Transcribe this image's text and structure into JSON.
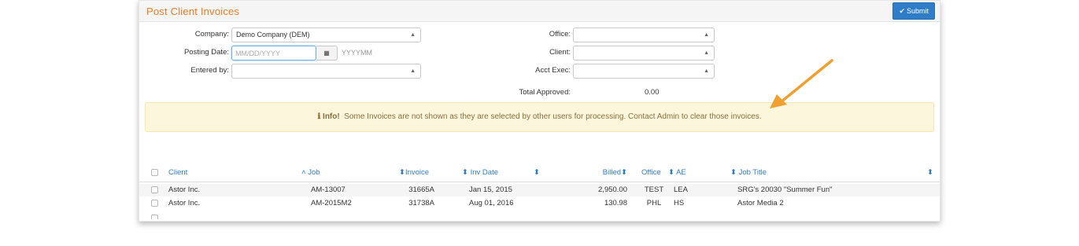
{
  "page": {
    "title": "Post Client Invoices",
    "submit_label": "Submit"
  },
  "form": {
    "company_label": "Company:",
    "company_value": "Demo Company (DEM)",
    "posting_date_label": "Posting Date:",
    "posting_date_placeholder": "MM/DD/YYYY",
    "period_placeholder": "YYYYMM",
    "entered_by_label": "Entered by:",
    "entered_by_value": "",
    "office_label": "Office:",
    "office_value": "",
    "client_label": "Client:",
    "client_value": "",
    "acct_exec_label": "Acct Exec:",
    "acct_exec_value": "",
    "total_approved_label": "Total Approved:",
    "total_approved_value": "0.00"
  },
  "info": {
    "prefix": "Info!",
    "message": "Some Invoices are not shown as they are selected by other users for processing. Contact Admin to clear those invoices."
  },
  "table": {
    "columns": {
      "client": "Client",
      "job": "Job",
      "invoice": "Invoice",
      "inv_date": "Inv Date",
      "billed": "Billed",
      "office": "Office",
      "ae": "AE",
      "job_title": "Job Title"
    },
    "rows": [
      {
        "client": "Astor Inc.",
        "job": "AM-13007",
        "invoice": "31665A",
        "inv_date": "Jan 15, 2015",
        "billed": "2,950.00",
        "office": "TEST",
        "ae": "LEA",
        "job_title": "SRG's 20030 \"Summer Fun\""
      },
      {
        "client": "Astor Inc.",
        "job": "AM-2015M2",
        "invoice": "31738A",
        "inv_date": "Aug 01, 2016",
        "billed": "130.98",
        "office": "PHL",
        "ae": "HS",
        "job_title": "Astor Media 2"
      }
    ]
  },
  "colors": {
    "accent": "#ee7b23",
    "link": "#2f7dc8",
    "info_bg": "#fcf7dc",
    "arrow": "#f0a030"
  },
  "icons": {
    "submit": "check-icon",
    "calendar": "calendar-icon",
    "info": "info-icon",
    "sort": "sort-icon",
    "select": "chevron-updown-icon"
  }
}
